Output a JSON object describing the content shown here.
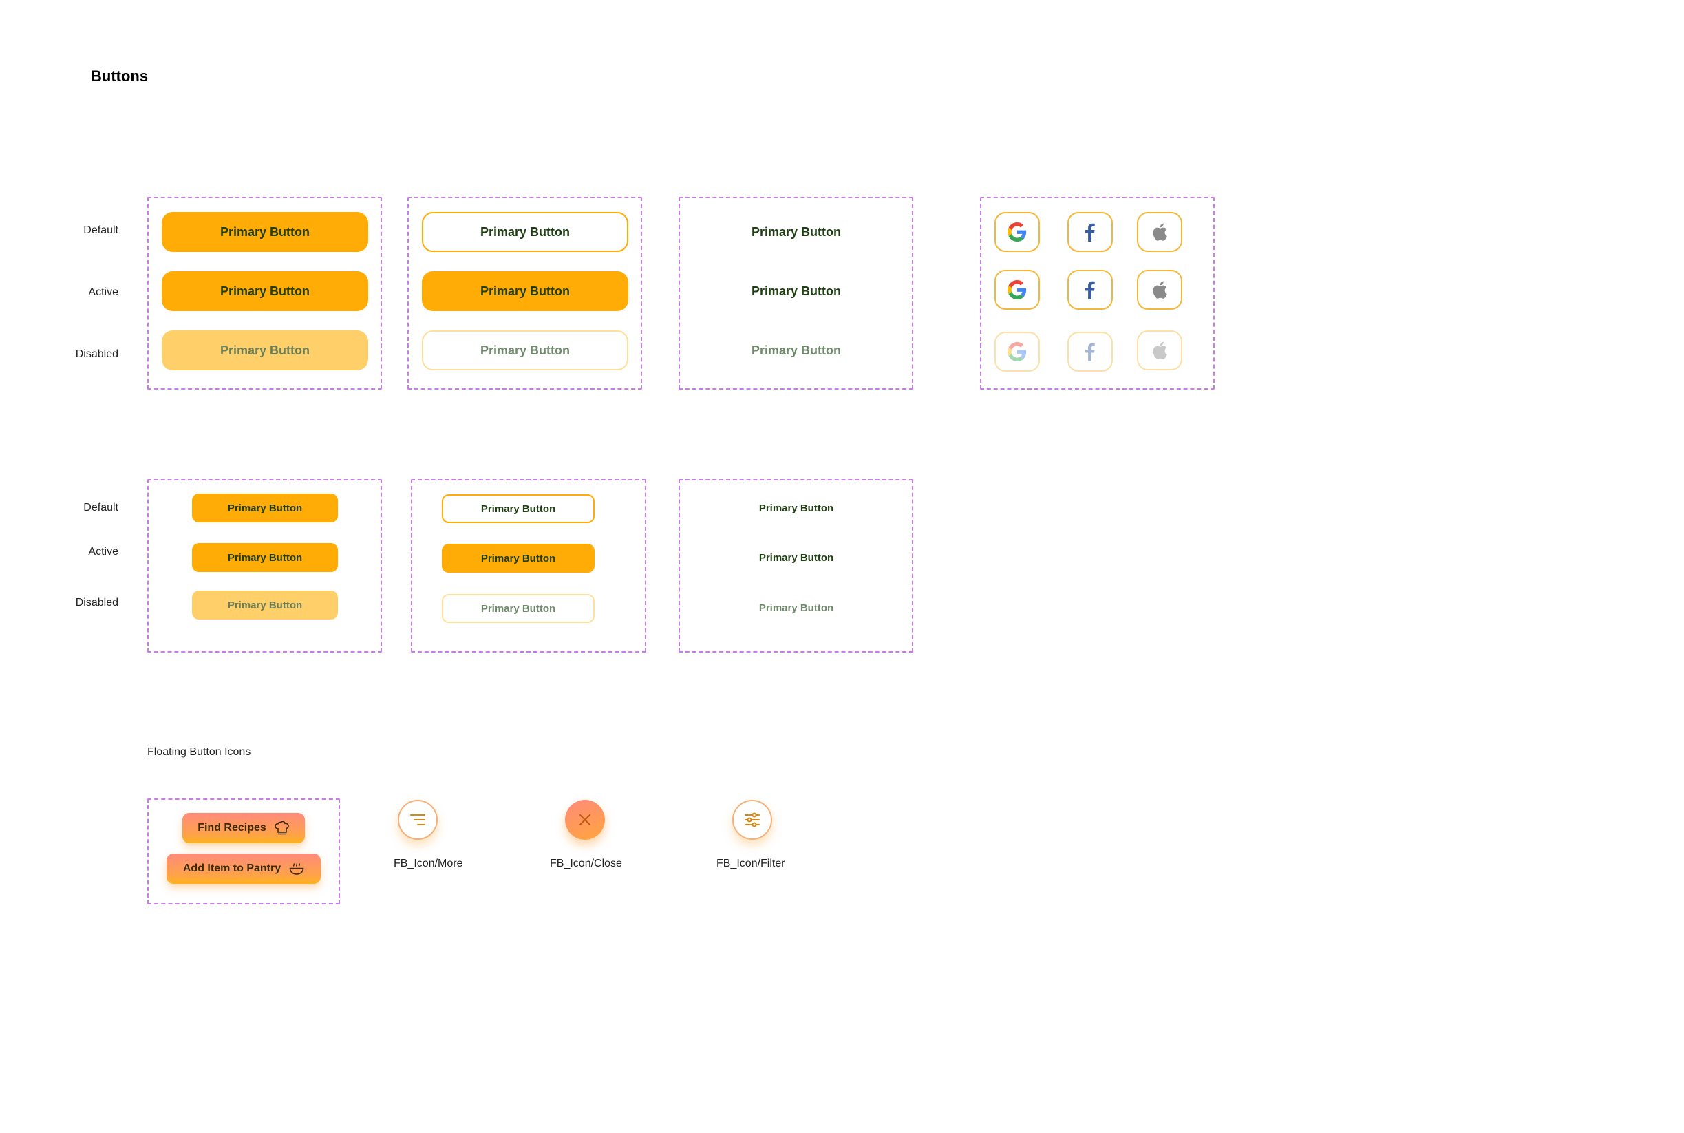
{
  "page": {
    "title": "Buttons"
  },
  "states": {
    "default": "Default",
    "active": "Active",
    "disabled": "Disabled"
  },
  "buttons": {
    "label": "Primary Button"
  },
  "floating": {
    "section_title": "Floating Button Icons",
    "find_recipes": "Find Recipes",
    "add_to_pantry": "Add Item to Pantry",
    "more_label": "FB_Icon/More",
    "close_label": "FB_Icon/Close",
    "filter_label": "FB_Icon/Filter"
  },
  "colors": {
    "primary": "#ffac06",
    "primary_disabled": "#ffcf6a",
    "text_dark_green": "#1e3f12",
    "text_disabled": "#6e8a6a",
    "frame_border": "#c77ce6",
    "fab_gradient_start": "#ff8b7c",
    "fab_gradient_end": "#ffa53c"
  },
  "icons": [
    "google-icon",
    "facebook-icon",
    "apple-icon",
    "chef-hat-icon",
    "pot-icon",
    "menu-lines-icon",
    "close-icon",
    "filter-sliders-icon"
  ]
}
